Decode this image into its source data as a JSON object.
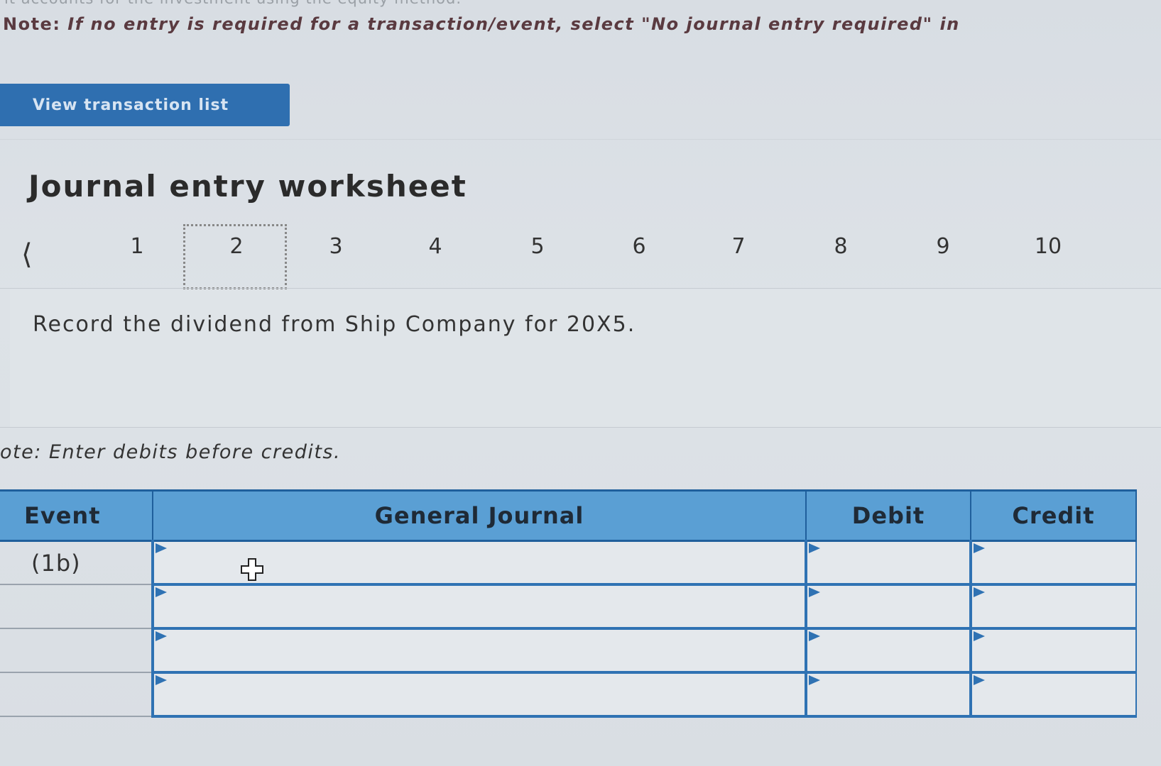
{
  "header": {
    "faded_line": "it accounts for the investment using the equity method.",
    "note_prefix": "Note:",
    "note_text": "If no entry is required for a transaction/event, select \"No journal entry required\" in"
  },
  "view_button": {
    "label": "View transaction list"
  },
  "worksheet": {
    "title": "Journal entry worksheet",
    "pages": [
      "1",
      "2",
      "3",
      "4",
      "5",
      "6",
      "7",
      "8",
      "9",
      "10"
    ],
    "active_page": "2",
    "prev_icon": "chevron-left-icon",
    "instruction": "Record the dividend from Ship Company for 20X5."
  },
  "entry_note": "ote: Enter debits before credits.",
  "journal_table": {
    "headers": {
      "event": "Event",
      "general_journal": "General Journal",
      "debit": "Debit",
      "credit": "Credit"
    },
    "rows": [
      {
        "event": "(1b)",
        "account": "",
        "debit": "",
        "credit": ""
      },
      {
        "event": "",
        "account": "",
        "debit": "",
        "credit": ""
      },
      {
        "event": "",
        "account": "",
        "debit": "",
        "credit": ""
      },
      {
        "event": "",
        "account": "",
        "debit": "",
        "credit": ""
      }
    ]
  },
  "colors": {
    "accent": "#2f6fb0",
    "header_bg": "#5a9fd4",
    "grid": "#2f72b3"
  }
}
